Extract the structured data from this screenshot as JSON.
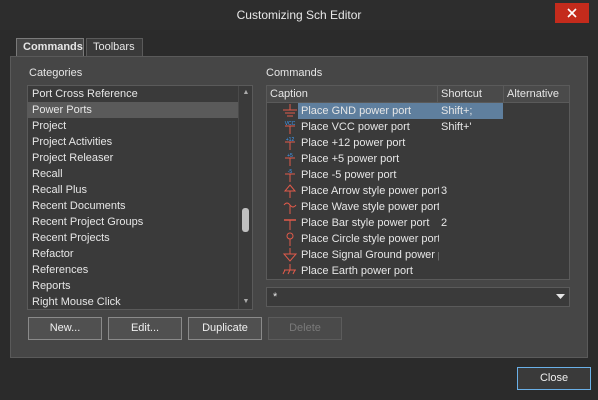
{
  "window": {
    "title": "Customizing Sch Editor",
    "close_icon": "close-icon"
  },
  "tabs": [
    {
      "label": "Commands",
      "active": true
    },
    {
      "label": "Toolbars",
      "active": false
    }
  ],
  "categories": {
    "label": "Categories",
    "selected": "Power Ports",
    "items": [
      "Port Cross Reference",
      "Power Ports",
      "Project",
      "Project Activities",
      "Project Releaser",
      "Recall",
      "Recall Plus",
      "Recent Documents",
      "Recent Project Groups",
      "Recent Projects",
      "Refactor",
      "References",
      "Reports",
      "Right Mouse Click"
    ]
  },
  "commands": {
    "label": "Commands",
    "columns": [
      "Caption",
      "Shortcut",
      "Alternative"
    ],
    "rows": [
      {
        "icon": "gnd-power-port-icon",
        "caption": "Place GND power port",
        "shortcut": "Shift+;",
        "selected": true
      },
      {
        "icon": "vcc-power-port-icon",
        "caption": "Place VCC power port",
        "shortcut": "Shift+'"
      },
      {
        "icon": "plus12-power-port-icon",
        "caption": "Place +12 power port",
        "shortcut": ""
      },
      {
        "icon": "plus5-power-port-icon",
        "caption": "Place +5 power port",
        "shortcut": ""
      },
      {
        "icon": "minus5-power-port-icon",
        "caption": "Place -5 power port",
        "shortcut": ""
      },
      {
        "icon": "arrow-power-port-icon",
        "caption": "Place Arrow style power port",
        "shortcut": "3"
      },
      {
        "icon": "wave-power-port-icon",
        "caption": "Place Wave style power port",
        "shortcut": ""
      },
      {
        "icon": "bar-power-port-icon",
        "caption": "Place Bar style power port",
        "shortcut": "2"
      },
      {
        "icon": "circle-power-port-icon",
        "caption": "Place Circle style power port",
        "shortcut": ""
      },
      {
        "icon": "signal-ground-icon",
        "caption": "Place Signal Ground power port",
        "shortcut": ""
      },
      {
        "icon": "earth-power-port-icon",
        "caption": "Place Earth power port",
        "shortcut": ""
      }
    ],
    "filter_value": "*"
  },
  "buttons": {
    "new": "New...",
    "edit": "Edit...",
    "duplicate": "Duplicate",
    "delete": "Delete",
    "close": "Close"
  },
  "colors": {
    "selection": "#5f7f9e",
    "icon_red": "#e05a4a",
    "icon_blue": "#3fa0ff",
    "close_red": "#c42b1c"
  }
}
